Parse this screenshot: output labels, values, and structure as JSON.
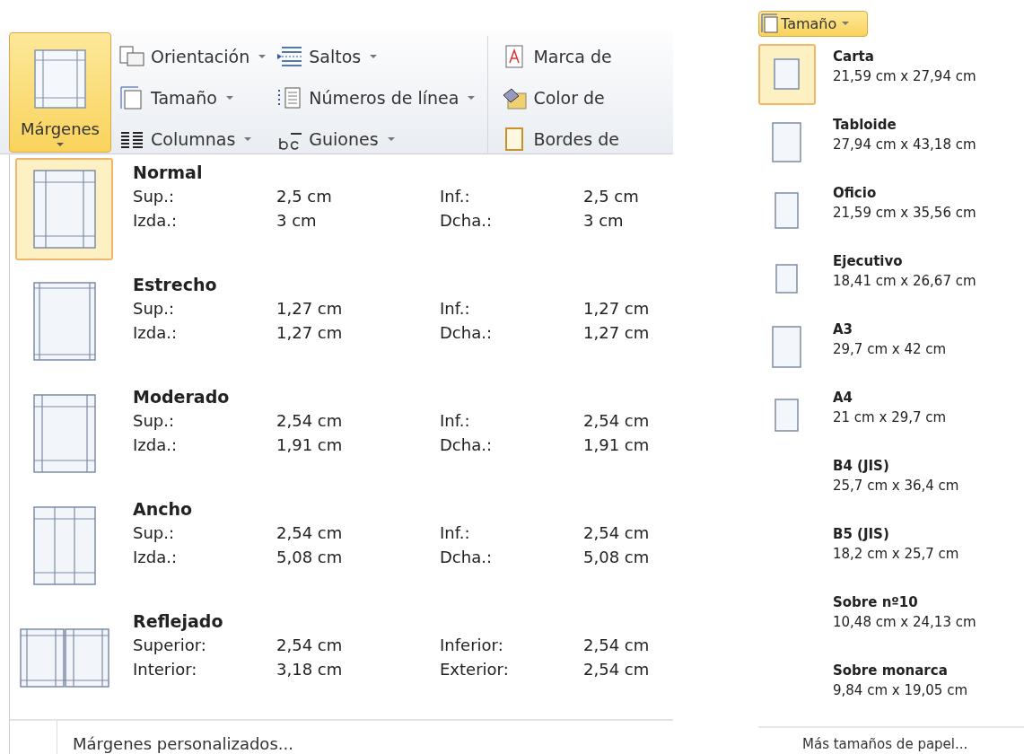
{
  "ribbon": {
    "margins_button": {
      "label": "Márgenes",
      "selected": true
    },
    "columns": [
      [
        {
          "label": "Orientación",
          "kind": "orientation",
          "dropdown": true
        },
        {
          "label": "Tamaño",
          "kind": "size",
          "dropdown": true
        },
        {
          "label": "Columnas",
          "kind": "columns",
          "dropdown": true
        }
      ],
      [
        {
          "label": "Saltos",
          "kind": "breaks",
          "dropdown": true
        },
        {
          "label": "Números de línea",
          "kind": "numbers",
          "dropdown": true
        },
        {
          "label": "Guiones",
          "kind": "hyphen",
          "dropdown": true
        }
      ],
      [
        {
          "label": "Marca de",
          "kind": "watermark",
          "dropdown": false
        },
        {
          "label": "Color de",
          "kind": "bucket",
          "dropdown": false
        },
        {
          "label": "Bordes de",
          "kind": "borders",
          "dropdown": false
        }
      ]
    ]
  },
  "margins_menu": {
    "items": [
      {
        "name": "Normal",
        "kind": "normal",
        "selected": true,
        "rows": [
          [
            "Sup.:",
            "2,5 cm",
            "Inf.:",
            "2,5 cm"
          ],
          [
            "Izda.:",
            "3 cm",
            "Dcha.:",
            "3 cm"
          ]
        ]
      },
      {
        "name": "Estrecho",
        "kind": "narrow",
        "selected": false,
        "rows": [
          [
            "Sup.:",
            "1,27 cm",
            "Inf.:",
            "1,27 cm"
          ],
          [
            "Izda.:",
            "1,27 cm",
            "Dcha.:",
            "1,27 cm"
          ]
        ]
      },
      {
        "name": "Moderado",
        "kind": "moderate",
        "selected": false,
        "rows": [
          [
            "Sup.:",
            "2,54 cm",
            "Inf.:",
            "2,54 cm"
          ],
          [
            "Izda.:",
            "1,91 cm",
            "Dcha.:",
            "1,91 cm"
          ]
        ]
      },
      {
        "name": "Ancho",
        "kind": "wide",
        "selected": false,
        "rows": [
          [
            "Sup.:",
            "2,54 cm",
            "Inf.:",
            "2,54 cm"
          ],
          [
            "Izda.:",
            "5,08 cm",
            "Dcha.:",
            "5,08 cm"
          ]
        ]
      },
      {
        "name": "Reflejado",
        "kind": "mirrored",
        "selected": false,
        "rows": [
          [
            "Superior:",
            "2,54 cm",
            "Inferior:",
            "2,54 cm"
          ],
          [
            "Interior:",
            "3,18 cm",
            "Exterior:",
            "2,54 cm"
          ]
        ]
      }
    ],
    "footer": "Márgenes personalizados..."
  },
  "size_menu": {
    "button": {
      "label": "Tamaño",
      "selected": true
    },
    "items": [
      {
        "name": "Carta",
        "dims": "21,59 cm x 27,94 cm",
        "kind": "letter",
        "selected": true
      },
      {
        "name": "Tabloide",
        "dims": "27,94 cm x 43,18 cm",
        "kind": "tabloid",
        "selected": false
      },
      {
        "name": "Oficio",
        "dims": "21,59 cm x 35,56 cm",
        "kind": "legal",
        "selected": false
      },
      {
        "name": "Ejecutivo",
        "dims": "18,41 cm x 26,67 cm",
        "kind": "executive",
        "selected": false
      },
      {
        "name": "A3",
        "dims": "29,7 cm x 42 cm",
        "kind": "a3",
        "selected": false
      },
      {
        "name": "A4",
        "dims": "21 cm x 29,7 cm",
        "kind": "a4",
        "selected": false
      },
      {
        "name": "B4 (JIS)",
        "dims": "25,7 cm x 36,4 cm",
        "selected": false
      },
      {
        "name": "B5 (JIS)",
        "dims": "18,2 cm x 25,7 cm",
        "selected": false
      },
      {
        "name": "Sobre nº10",
        "dims": "10,48 cm x 24,13 cm",
        "selected": false
      },
      {
        "name": "Sobre monarca",
        "dims": "9,84 cm x 19,05 cm",
        "selected": false
      }
    ],
    "footer": "Más tamaños de papel..."
  }
}
